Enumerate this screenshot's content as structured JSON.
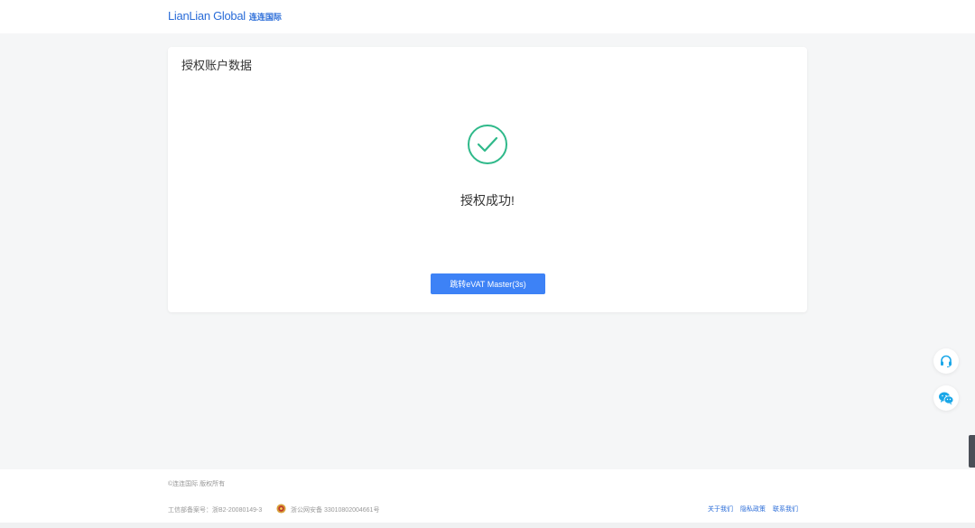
{
  "header": {
    "logo_en": "LianLian Global",
    "logo_cn": "连连国际"
  },
  "card": {
    "title": "授权账户数据",
    "status_icon": "check-circle-icon",
    "success_text": "授权成功!",
    "jump_button_label": "跳转eVAT Master(3s)"
  },
  "floating": {
    "support_icon": "headset-icon",
    "wechat_icon": "wechat-icon"
  },
  "footer": {
    "copyright": "©连连国际 版权所有",
    "icp": "工信部备案号：浙B2-20080149-3",
    "police_record": "浙公网安备 33010802004661号",
    "links": [
      "关于我们",
      "隐私政策",
      "联系我们"
    ]
  },
  "colors": {
    "brand": "#2a6cd8",
    "button": "#3d82f6",
    "success": "#2fb98a",
    "float_icon": "#1aa7e8"
  }
}
